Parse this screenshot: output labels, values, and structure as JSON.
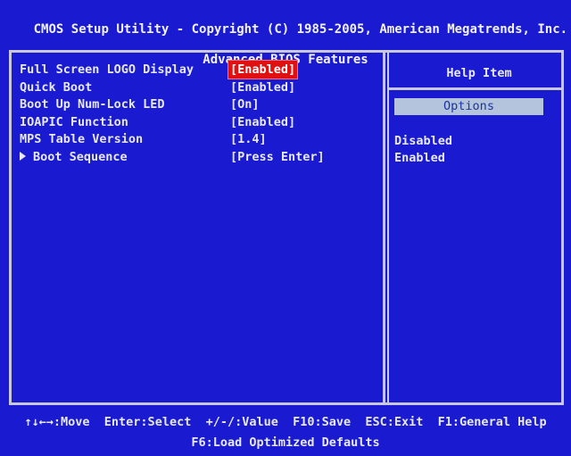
{
  "header": {
    "line1": "CMOS Setup Utility - Copyright (C) 1985-2005, American Megatrends, Inc.",
    "line2": "Advanced BIOS Features"
  },
  "settings": [
    {
      "name": "Full Screen LOGO Display",
      "value": "[Enabled]",
      "selected": true
    },
    {
      "name": "Quick Boot",
      "value": "[Enabled]"
    },
    {
      "name": "Boot Up Num-Lock LED",
      "value": "[On]"
    },
    {
      "name": "IOAPIC Function",
      "value": "[Enabled]"
    },
    {
      "name": "MPS Table Version",
      "value": "[1.4]"
    },
    {
      "name": "Boot Sequence",
      "value": "[Press Enter]",
      "submenu": true
    }
  ],
  "help": {
    "title": "Help Item",
    "options_label": "Options",
    "options": [
      "Disabled",
      "Enabled"
    ]
  },
  "footer": {
    "line1": "↑↓←→:Move  Enter:Select  +/-/:Value  F10:Save  ESC:Exit  F1:General Help",
    "line2": "F6:Load Optimized Defaults"
  },
  "colors": {
    "background": "#1a1ad0",
    "selected_value": "#e01010",
    "options_bar": "#b4c4dc"
  }
}
